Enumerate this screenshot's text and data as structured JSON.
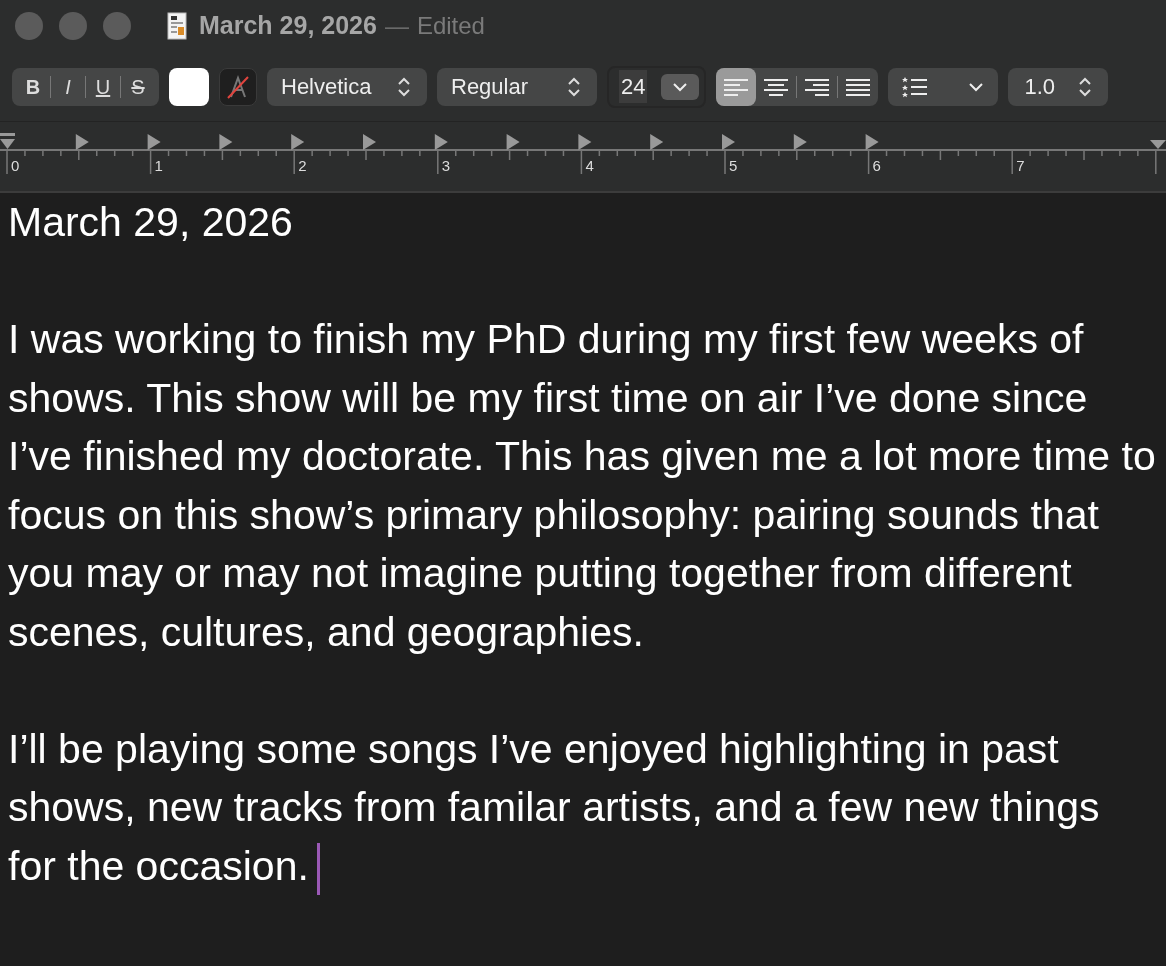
{
  "window": {
    "title": "March 29, 2026",
    "separator": "—",
    "status": "Edited"
  },
  "toolbar": {
    "styles": [
      {
        "label": "B",
        "kind": "bold"
      },
      {
        "label": "I",
        "kind": "italic"
      },
      {
        "label": "U",
        "kind": "underline"
      },
      {
        "label": "S",
        "kind": "strike"
      }
    ],
    "font": "Helvetica",
    "typeface": "Regular",
    "size": "24",
    "alignments": [
      {
        "kind": "left",
        "selected": true
      },
      {
        "kind": "center",
        "selected": false
      },
      {
        "kind": "right",
        "selected": false
      },
      {
        "kind": "justify",
        "selected": false
      }
    ],
    "spacing": "1.0"
  },
  "ruler": {
    "labels": [
      "0",
      "1",
      "2",
      "3",
      "4",
      "5",
      "6",
      "7"
    ]
  },
  "document": {
    "paragraphs": [
      "March 29, 2026",
      "I was working to finish my PhD during my first few weeks of shows. This show will be my first time on air I’ve done since I’ve finished my doctorate. This has given me a lot more time to focus on this show’s primary philosophy: pairing sounds that you may or may not imagine putting together from different scenes, cultures, and geographies.",
      "I’ll be playing some songs I’ve enjoyed highlighting in past shows, new tracks from familar artists, and a few new things for the occasion."
    ]
  }
}
